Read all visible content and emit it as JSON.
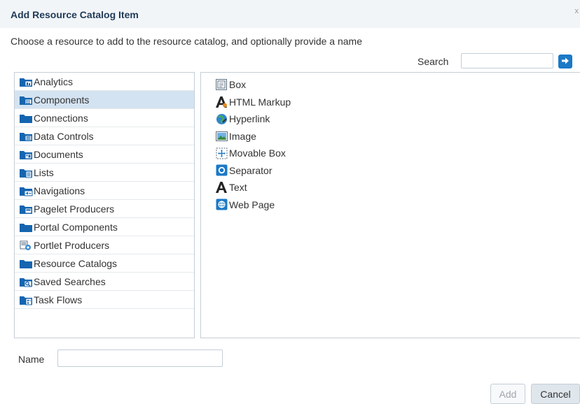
{
  "dialog": {
    "title": "Add Resource Catalog Item",
    "close_glyph": "x",
    "instructions": "Choose a resource to add to the resource catalog, and optionally provide a name"
  },
  "search": {
    "label": "Search",
    "value": "",
    "placeholder": "",
    "go_icon": "arrow-right-icon"
  },
  "categories": [
    {
      "label": "Analytics",
      "icon": "folder-analytics-icon",
      "selected": false
    },
    {
      "label": "Components",
      "icon": "folder-components-icon",
      "selected": true
    },
    {
      "label": "Connections",
      "icon": "folder-icon",
      "selected": false
    },
    {
      "label": "Data Controls",
      "icon": "folder-data-controls-icon",
      "selected": false
    },
    {
      "label": "Documents",
      "icon": "folder-documents-icon",
      "selected": false
    },
    {
      "label": "Lists",
      "icon": "folder-lists-icon",
      "selected": false
    },
    {
      "label": "Navigations",
      "icon": "folder-navigations-icon",
      "selected": false
    },
    {
      "label": "Pagelet Producers",
      "icon": "folder-pagelet-icon",
      "selected": false
    },
    {
      "label": "Portal Components",
      "icon": "folder-icon",
      "selected": false
    },
    {
      "label": "Portlet Producers",
      "icon": "portlet-producer-icon",
      "selected": false
    },
    {
      "label": "Resource Catalogs",
      "icon": "folder-icon",
      "selected": false
    },
    {
      "label": "Saved Searches",
      "icon": "folder-saved-searches-icon",
      "selected": false
    },
    {
      "label": "Task Flows",
      "icon": "folder-task-flows-icon",
      "selected": false
    }
  ],
  "resources": [
    {
      "label": "Box",
      "icon": "box-icon"
    },
    {
      "label": "HTML Markup",
      "icon": "html-markup-icon"
    },
    {
      "label": "Hyperlink",
      "icon": "hyperlink-globe-icon"
    },
    {
      "label": "Image",
      "icon": "image-icon"
    },
    {
      "label": "Movable Box",
      "icon": "movable-box-icon"
    },
    {
      "label": "Separator",
      "icon": "separator-icon"
    },
    {
      "label": "Text",
      "icon": "text-icon"
    },
    {
      "label": "Web Page",
      "icon": "web-page-icon"
    }
  ],
  "name_field": {
    "label": "Name",
    "value": "",
    "placeholder": ""
  },
  "buttons": {
    "add_label": "Add",
    "cancel_label": "Cancel"
  },
  "colors": {
    "accent": "#1b79c7",
    "folder": "#1565b0",
    "selected_row": "#d4e3f1",
    "title_text": "#1f3a57"
  }
}
